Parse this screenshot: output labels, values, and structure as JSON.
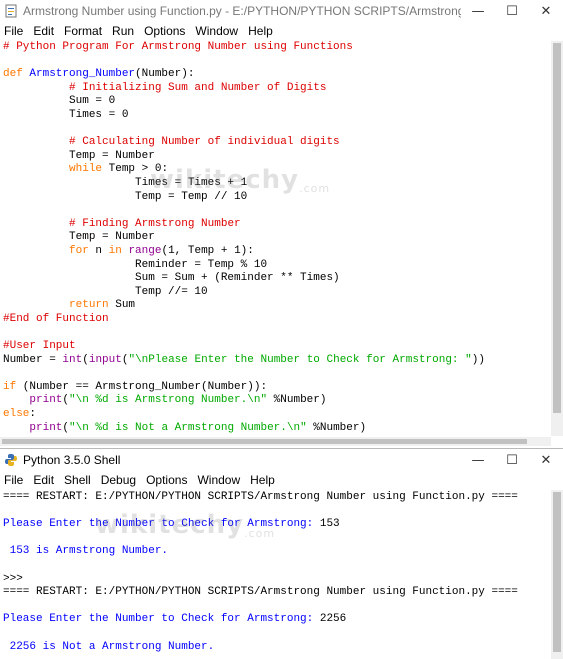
{
  "editor": {
    "title": "Armstrong Number using Function.py - E:/PYTHON/PYTHON SCRIPTS/Armstrong Number ...",
    "menu": [
      "File",
      "Edit",
      "Format",
      "Run",
      "Options",
      "Window",
      "Help"
    ],
    "code_lines": [
      [
        {
          "t": "# Python Program For Armstrong Number using Functions",
          "c": "cm"
        }
      ],
      [],
      [
        {
          "t": "def ",
          "c": "kw"
        },
        {
          "t": "Armstrong_Number",
          "c": "fn"
        },
        {
          "t": "(Number):",
          "c": ""
        }
      ],
      [
        {
          "t": "          ",
          "c": ""
        },
        {
          "t": "# Initializing Sum and Number of Digits",
          "c": "cm"
        }
      ],
      [
        {
          "t": "          Sum = 0",
          "c": ""
        }
      ],
      [
        {
          "t": "          Times = 0",
          "c": ""
        }
      ],
      [],
      [
        {
          "t": "          ",
          "c": ""
        },
        {
          "t": "# Calculating Number of individual digits",
          "c": "cm"
        }
      ],
      [
        {
          "t": "          Temp = Number",
          "c": ""
        }
      ],
      [
        {
          "t": "          ",
          "c": ""
        },
        {
          "t": "while",
          "c": "kw"
        },
        {
          "t": " Temp > 0:",
          "c": ""
        }
      ],
      [
        {
          "t": "                    Times = Times + 1",
          "c": ""
        }
      ],
      [
        {
          "t": "                    Temp = Temp // 10",
          "c": ""
        }
      ],
      [],
      [
        {
          "t": "          ",
          "c": ""
        },
        {
          "t": "# Finding Armstrong Number",
          "c": "cm"
        }
      ],
      [
        {
          "t": "          Temp = Number",
          "c": ""
        }
      ],
      [
        {
          "t": "          ",
          "c": ""
        },
        {
          "t": "for",
          "c": "kw"
        },
        {
          "t": " n ",
          "c": ""
        },
        {
          "t": "in",
          "c": "kw"
        },
        {
          "t": " ",
          "c": ""
        },
        {
          "t": "range",
          "c": "bi"
        },
        {
          "t": "(1, Temp + 1):",
          "c": ""
        }
      ],
      [
        {
          "t": "                    Reminder = Temp % 10",
          "c": ""
        }
      ],
      [
        {
          "t": "                    Sum = Sum + (Reminder ** Times)",
          "c": ""
        }
      ],
      [
        {
          "t": "                    Temp //= 10",
          "c": ""
        }
      ],
      [
        {
          "t": "          ",
          "c": ""
        },
        {
          "t": "return",
          "c": "kw"
        },
        {
          "t": " Sum",
          "c": ""
        }
      ],
      [
        {
          "t": "#End of Function",
          "c": "cm"
        }
      ],
      [],
      [
        {
          "t": "#User Input",
          "c": "cm"
        }
      ],
      [
        {
          "t": "Number = ",
          "c": ""
        },
        {
          "t": "int",
          "c": "bi"
        },
        {
          "t": "(",
          "c": ""
        },
        {
          "t": "input",
          "c": "bi"
        },
        {
          "t": "(",
          "c": ""
        },
        {
          "t": "\"\\nPlease Enter the Number to Check for Armstrong: \"",
          "c": "st"
        },
        {
          "t": "))",
          "c": ""
        }
      ],
      [],
      [
        {
          "t": "if",
          "c": "kw"
        },
        {
          "t": " (Number == Armstrong_Number(Number)):",
          "c": ""
        }
      ],
      [
        {
          "t": "    ",
          "c": ""
        },
        {
          "t": "print",
          "c": "bi"
        },
        {
          "t": "(",
          "c": ""
        },
        {
          "t": "\"\\n %d is Armstrong Number.\\n\"",
          "c": "st"
        },
        {
          "t": " %Number)",
          "c": ""
        }
      ],
      [
        {
          "t": "else",
          "c": "kw"
        },
        {
          "t": ":",
          "c": ""
        }
      ],
      [
        {
          "t": "    ",
          "c": ""
        },
        {
          "t": "print",
          "c": "bi"
        },
        {
          "t": "(",
          "c": ""
        },
        {
          "t": "\"\\n %d is Not a Armstrong Number.\\n\"",
          "c": "st"
        },
        {
          "t": " %Number)",
          "c": ""
        }
      ]
    ]
  },
  "shell": {
    "title": "Python 3.5.0 Shell",
    "menu": [
      "File",
      "Edit",
      "Shell",
      "Debug",
      "Options",
      "Window",
      "Help"
    ],
    "lines": [
      [
        {
          "t": "==== RESTART: E:/PYTHON/PYTHON SCRIPTS/Armstrong Number using Function.py ====",
          "c": ""
        }
      ],
      [],
      [
        {
          "t": "Please Enter the Number to Check for Armstrong: ",
          "c": "out"
        },
        {
          "t": "153",
          "c": ""
        }
      ],
      [],
      [
        {
          "t": " 153 is Armstrong Number.",
          "c": "out"
        }
      ],
      [],
      [
        {
          "t": ">>>",
          "c": ""
        }
      ],
      [
        {
          "t": "==== RESTART: E:/PYTHON/PYTHON SCRIPTS/Armstrong Number using Function.py ====",
          "c": ""
        }
      ],
      [],
      [
        {
          "t": "Please Enter the Number to Check for Armstrong: ",
          "c": "out"
        },
        {
          "t": "2256",
          "c": ""
        }
      ],
      [],
      [
        {
          "t": " 2256 is Not a Armstrong Number.",
          "c": "out"
        }
      ]
    ]
  },
  "watermark": {
    "brand": "wikitechy",
    "domain": ".com"
  }
}
